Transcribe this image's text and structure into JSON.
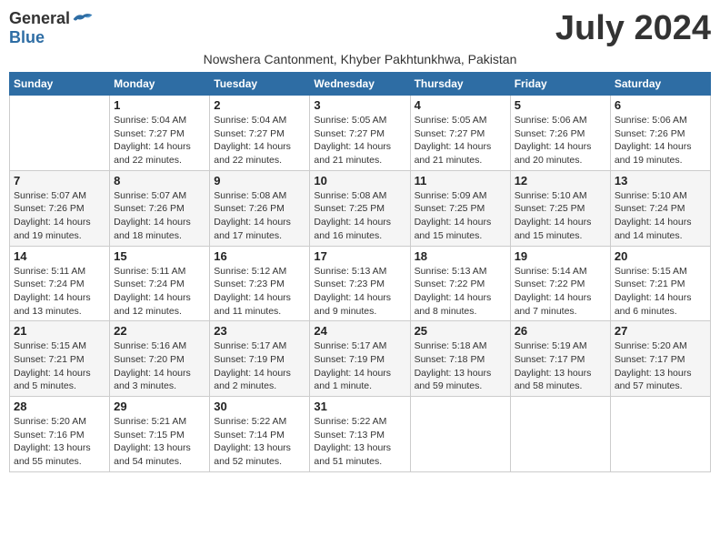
{
  "header": {
    "logo_general": "General",
    "logo_blue": "Blue",
    "month_title": "July 2024",
    "subtitle": "Nowshera Cantonment, Khyber Pakhtunkhwa, Pakistan"
  },
  "days_of_week": [
    "Sunday",
    "Monday",
    "Tuesday",
    "Wednesday",
    "Thursday",
    "Friday",
    "Saturday"
  ],
  "weeks": [
    [
      {
        "day": "",
        "info": ""
      },
      {
        "day": "1",
        "info": "Sunrise: 5:04 AM\nSunset: 7:27 PM\nDaylight: 14 hours\nand 22 minutes."
      },
      {
        "day": "2",
        "info": "Sunrise: 5:04 AM\nSunset: 7:27 PM\nDaylight: 14 hours\nand 22 minutes."
      },
      {
        "day": "3",
        "info": "Sunrise: 5:05 AM\nSunset: 7:27 PM\nDaylight: 14 hours\nand 21 minutes."
      },
      {
        "day": "4",
        "info": "Sunrise: 5:05 AM\nSunset: 7:27 PM\nDaylight: 14 hours\nand 21 minutes."
      },
      {
        "day": "5",
        "info": "Sunrise: 5:06 AM\nSunset: 7:26 PM\nDaylight: 14 hours\nand 20 minutes."
      },
      {
        "day": "6",
        "info": "Sunrise: 5:06 AM\nSunset: 7:26 PM\nDaylight: 14 hours\nand 19 minutes."
      }
    ],
    [
      {
        "day": "7",
        "info": "Sunrise: 5:07 AM\nSunset: 7:26 PM\nDaylight: 14 hours\nand 19 minutes."
      },
      {
        "day": "8",
        "info": "Sunrise: 5:07 AM\nSunset: 7:26 PM\nDaylight: 14 hours\nand 18 minutes."
      },
      {
        "day": "9",
        "info": "Sunrise: 5:08 AM\nSunset: 7:26 PM\nDaylight: 14 hours\nand 17 minutes."
      },
      {
        "day": "10",
        "info": "Sunrise: 5:08 AM\nSunset: 7:25 PM\nDaylight: 14 hours\nand 16 minutes."
      },
      {
        "day": "11",
        "info": "Sunrise: 5:09 AM\nSunset: 7:25 PM\nDaylight: 14 hours\nand 15 minutes."
      },
      {
        "day": "12",
        "info": "Sunrise: 5:10 AM\nSunset: 7:25 PM\nDaylight: 14 hours\nand 15 minutes."
      },
      {
        "day": "13",
        "info": "Sunrise: 5:10 AM\nSunset: 7:24 PM\nDaylight: 14 hours\nand 14 minutes."
      }
    ],
    [
      {
        "day": "14",
        "info": "Sunrise: 5:11 AM\nSunset: 7:24 PM\nDaylight: 14 hours\nand 13 minutes."
      },
      {
        "day": "15",
        "info": "Sunrise: 5:11 AM\nSunset: 7:24 PM\nDaylight: 14 hours\nand 12 minutes."
      },
      {
        "day": "16",
        "info": "Sunrise: 5:12 AM\nSunset: 7:23 PM\nDaylight: 14 hours\nand 11 minutes."
      },
      {
        "day": "17",
        "info": "Sunrise: 5:13 AM\nSunset: 7:23 PM\nDaylight: 14 hours\nand 9 minutes."
      },
      {
        "day": "18",
        "info": "Sunrise: 5:13 AM\nSunset: 7:22 PM\nDaylight: 14 hours\nand 8 minutes."
      },
      {
        "day": "19",
        "info": "Sunrise: 5:14 AM\nSunset: 7:22 PM\nDaylight: 14 hours\nand 7 minutes."
      },
      {
        "day": "20",
        "info": "Sunrise: 5:15 AM\nSunset: 7:21 PM\nDaylight: 14 hours\nand 6 minutes."
      }
    ],
    [
      {
        "day": "21",
        "info": "Sunrise: 5:15 AM\nSunset: 7:21 PM\nDaylight: 14 hours\nand 5 minutes."
      },
      {
        "day": "22",
        "info": "Sunrise: 5:16 AM\nSunset: 7:20 PM\nDaylight: 14 hours\nand 3 minutes."
      },
      {
        "day": "23",
        "info": "Sunrise: 5:17 AM\nSunset: 7:19 PM\nDaylight: 14 hours\nand 2 minutes."
      },
      {
        "day": "24",
        "info": "Sunrise: 5:17 AM\nSunset: 7:19 PM\nDaylight: 14 hours\nand 1 minute."
      },
      {
        "day": "25",
        "info": "Sunrise: 5:18 AM\nSunset: 7:18 PM\nDaylight: 13 hours\nand 59 minutes."
      },
      {
        "day": "26",
        "info": "Sunrise: 5:19 AM\nSunset: 7:17 PM\nDaylight: 13 hours\nand 58 minutes."
      },
      {
        "day": "27",
        "info": "Sunrise: 5:20 AM\nSunset: 7:17 PM\nDaylight: 13 hours\nand 57 minutes."
      }
    ],
    [
      {
        "day": "28",
        "info": "Sunrise: 5:20 AM\nSunset: 7:16 PM\nDaylight: 13 hours\nand 55 minutes."
      },
      {
        "day": "29",
        "info": "Sunrise: 5:21 AM\nSunset: 7:15 PM\nDaylight: 13 hours\nand 54 minutes."
      },
      {
        "day": "30",
        "info": "Sunrise: 5:22 AM\nSunset: 7:14 PM\nDaylight: 13 hours\nand 52 minutes."
      },
      {
        "day": "31",
        "info": "Sunrise: 5:22 AM\nSunset: 7:13 PM\nDaylight: 13 hours\nand 51 minutes."
      },
      {
        "day": "",
        "info": ""
      },
      {
        "day": "",
        "info": ""
      },
      {
        "day": "",
        "info": ""
      }
    ]
  ]
}
